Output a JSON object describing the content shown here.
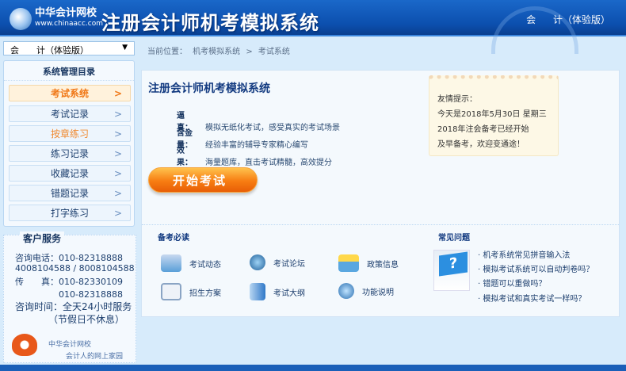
{
  "header": {
    "logo_name": "中华会计网校",
    "logo_url": "www.chinaacc.com",
    "title": "注册会计师机考模拟系统",
    "edition": "会 计（体验版）"
  },
  "sidebar": {
    "subject_select": "会　　计（体验版）",
    "select_arrow": "▼",
    "menu_title": "系统管理目录",
    "items": [
      {
        "label": "考试系统"
      },
      {
        "label": "考试记录"
      },
      {
        "label": "按章练习"
      },
      {
        "label": "练习记录"
      },
      {
        "label": "收藏记录"
      },
      {
        "label": "错题记录"
      },
      {
        "label": "打字练习"
      }
    ],
    "chevron": ">",
    "service": {
      "title": "客户服务",
      "lines": [
        "咨询电话：010-82318888",
        "4008104588 / 8008104588",
        "传　　真：010-82330109",
        "　　　　　010-82318888",
        "咨询时间：全天24小时服务",
        "　　　　（节假日不休息）"
      ],
      "brand1": "中华会计网校",
      "brand2": "会计人的网上家园"
    }
  },
  "breadcrumb": "当前位置： 机考模拟系统 > 考试系统",
  "main": {
    "title": "注册会计师机考模拟系统",
    "features": [
      {
        "k": "逼　真：",
        "v": "模拟无纸化考试，感受真实的考试场景"
      },
      {
        "k": "含金量：",
        "v": "经验丰富的辅导专家精心编写"
      },
      {
        "k": "效　果：",
        "v": "海量题库，直击考试精髓，高效提分"
      }
    ],
    "start_button": "开始考试",
    "tips": [
      "友情提示：",
      "今天是2018年5月30日 星期三",
      "2018年注会备考已经开始",
      "及早备考，欢迎变通途！"
    ],
    "must_read": {
      "title": "备考必读",
      "links": [
        "考试动态",
        "考试论坛",
        "政策信息",
        "招生方案",
        "考试大纲",
        "功能说明"
      ]
    },
    "faq": {
      "title": "常见问题",
      "items": [
        "· 机考系统常见拼音输入法",
        "· 模拟考试系统可以自动判卷吗？",
        "· 错题可以重做吗？",
        "· 模拟考试和真实考试一样吗？"
      ]
    }
  }
}
